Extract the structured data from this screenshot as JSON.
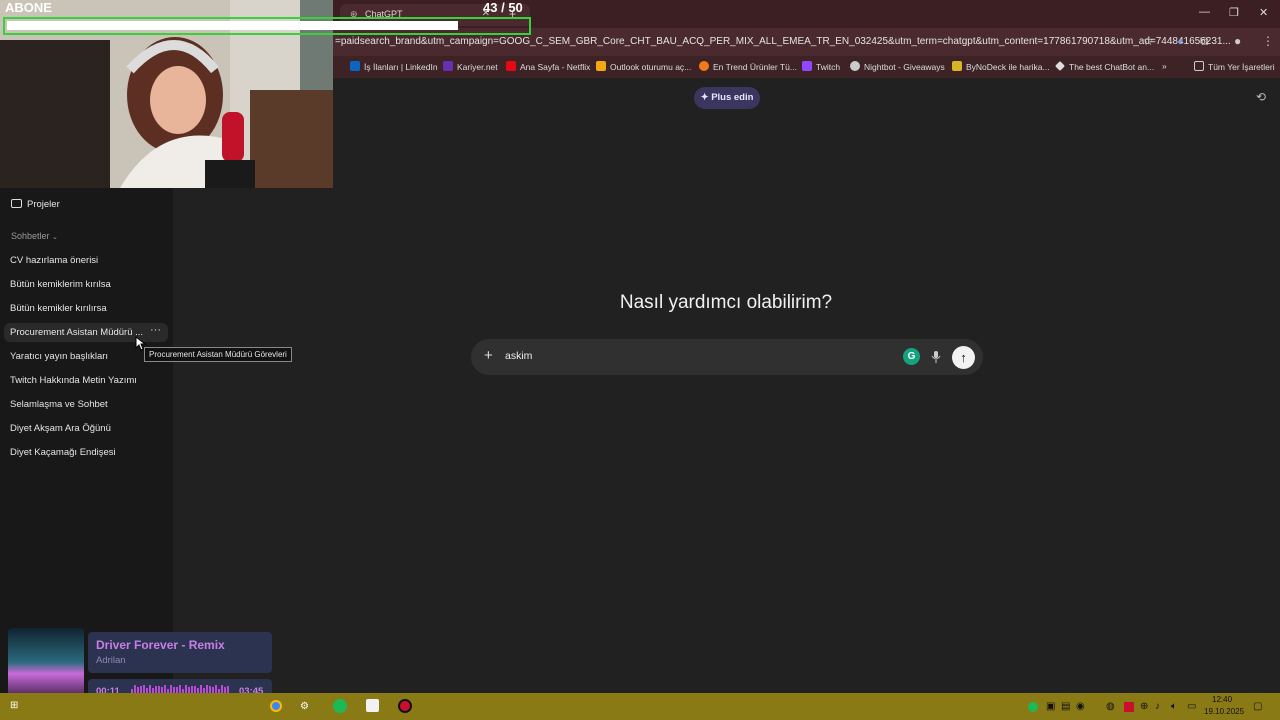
{
  "stream_overlay": {
    "sub_label": "ABONE",
    "goal_current": "43",
    "goal_target": "/ 50",
    "goal_progress": 0.86
  },
  "browser": {
    "tab_title": "ChatGPT",
    "url": "=paidsearch_brand&utm_campaign=GOOG_C_SEM_GBR_Core_CHT_BAU_ACQ_PER_MIX_ALL_EMEA_TR_EN_032425&utm_term=chatgpt&utm_content=177861790718&utm_ad=744841656231...",
    "bookmarks": [
      {
        "label": "İş İlanları | LinkedIn",
        "icon": "linkedin-icon",
        "color": "#0a66c2"
      },
      {
        "label": "Kariyer.net",
        "icon": "kariyer-icon",
        "color": "#6a2fb0"
      },
      {
        "label": "Ana Sayfa - Netflix",
        "icon": "netflix-icon",
        "color": "#e50914"
      },
      {
        "label": "Outlook oturumu aç...",
        "icon": "microsoft-icon",
        "color": "#f3a712"
      },
      {
        "label": "En Trend Ürünler Tü...",
        "icon": "trendyol-icon",
        "color": "#f27a1a"
      },
      {
        "label": "Twitch",
        "icon": "twitch-icon",
        "color": "#9146ff"
      },
      {
        "label": "Nightbot - Giveaways",
        "icon": "nightbot-icon",
        "color": "#cccccc"
      },
      {
        "label": "ByNoDeck ile harika...",
        "icon": "bynodeck-icon",
        "color": "#d9b526"
      },
      {
        "label": "The best ChatBot an...",
        "icon": "chatbot-icon",
        "color": "#dddddd"
      }
    ],
    "all_bookmarks_label": "Tüm Yer İşaretleri"
  },
  "sidebar": {
    "projects_label": "Projeler",
    "chats_header": "Sohbetler",
    "chats": [
      "CV hazırlama önerisi",
      "Bütün kemiklerim kırılsa",
      "Bütün kemikler kırılırsa",
      "Procurement Asistan Müdürü ...",
      "Yaratıcı yayın başlıkları",
      "Twitch Hakkında Metin Yazımı",
      "Selamlaşma ve Sohbet",
      "Diyet Akşam Ara Öğünü",
      "Diyet Kaçamağı Endişesi"
    ],
    "tooltip": "Procurement Asistan Müdürü Görevleri"
  },
  "main": {
    "plus_label": "Plus edin",
    "heading": "Nasıl yardımcı olabilirim?",
    "composer_value": "askim"
  },
  "now_playing": {
    "title": "Driver Forever - Remix",
    "artist": "Adrilan",
    "elapsed": "00:11",
    "total": "03:45"
  },
  "taskbar": {
    "time": "12:40",
    "date": "19.10.2025"
  }
}
